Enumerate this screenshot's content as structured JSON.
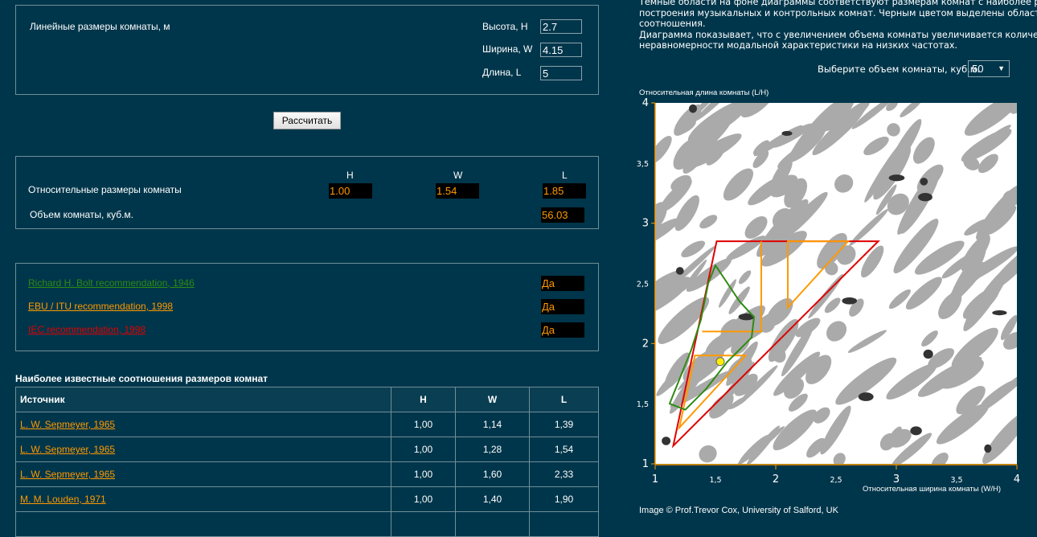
{
  "dimensions": {
    "title": "Линейные размеры комнаты, м",
    "fields": [
      {
        "label": "Высота, H",
        "value": "2.7"
      },
      {
        "label": "Ширина, W",
        "value": "4.15"
      },
      {
        "label": "Длина, L",
        "value": "5"
      }
    ]
  },
  "calculate_label": "Рассчитать",
  "relative": {
    "label": "Относительные размеры комнаты",
    "headers": [
      "H",
      "W",
      "L"
    ],
    "values": [
      "1.00",
      "1.54",
      "1.85"
    ],
    "volume_label": "Объем комнаты, куб.м.",
    "volume_value": "56.03"
  },
  "recommendations": [
    {
      "label": "Richard H. Bolt recommendation, 1946",
      "result": "Да",
      "color": "#2e8b12"
    },
    {
      "label": "EBU / ITU recommendation, 1998",
      "result": "Да",
      "color": "#ff9900"
    },
    {
      "label": "IEC recommendation, 1998",
      "result": "Да",
      "color": "#e00000"
    }
  ],
  "ratios_table": {
    "title": "Наиболее известные соотношения размеров комнат",
    "headers": [
      "Источник",
      "H",
      "W",
      "L"
    ],
    "rows": [
      [
        "L. W. Sepmeyer, 1965",
        "1,00",
        "1,14",
        "1,39"
      ],
      [
        "L. W. Sepmeyer, 1965",
        "1,00",
        "1,28",
        "1,54"
      ],
      [
        "L. W. Sepmeyer, 1965",
        "1,00",
        "1,60",
        "2,33"
      ],
      [
        "M. M. Louden, 1971",
        "1,00",
        "1,40",
        "1,90"
      ]
    ]
  },
  "description": [
    "Темные области на фоне диаграммы соответствуют размерам комнат с наиболее ровной",
    "построения музыкальных и контрольных комнат. Черным цветом выделены области \"луч",
    "соотношения.",
    "Диаграмма показывает, что с увеличением объема комнаты увеличивается количество п",
    "неравномерности модальной характеристики на низких частотах."
  ],
  "volume_select": {
    "label": "Выберите объем комнаты, куб.м.",
    "value": "50"
  },
  "chart_data": {
    "type": "scatter",
    "ylabel": "Относительная длина комнаты (L/H)",
    "xlabel": "Относительная ширина комнаты (W/H)",
    "xlim": [
      1,
      4
    ],
    "ylim": [
      1,
      4
    ],
    "xticks": [
      "1",
      "1,5",
      "2",
      "2,5",
      "3",
      "3,5",
      "4"
    ],
    "yticks": [
      "1",
      "1,5",
      "2",
      "2,5",
      "3",
      "3,5",
      "4"
    ],
    "point": {
      "x": 1.54,
      "y": 1.85,
      "color": "#ffee00"
    },
    "colors": {
      "axis": "#ff9900",
      "bolt": "#2e8b12",
      "ebu": "#ff9900",
      "iec": "#e00000",
      "good": "#aaaaaa",
      "best": "#333333"
    }
  },
  "credit": "Image © Prof.Trevor Cox, University of Salford, UK"
}
